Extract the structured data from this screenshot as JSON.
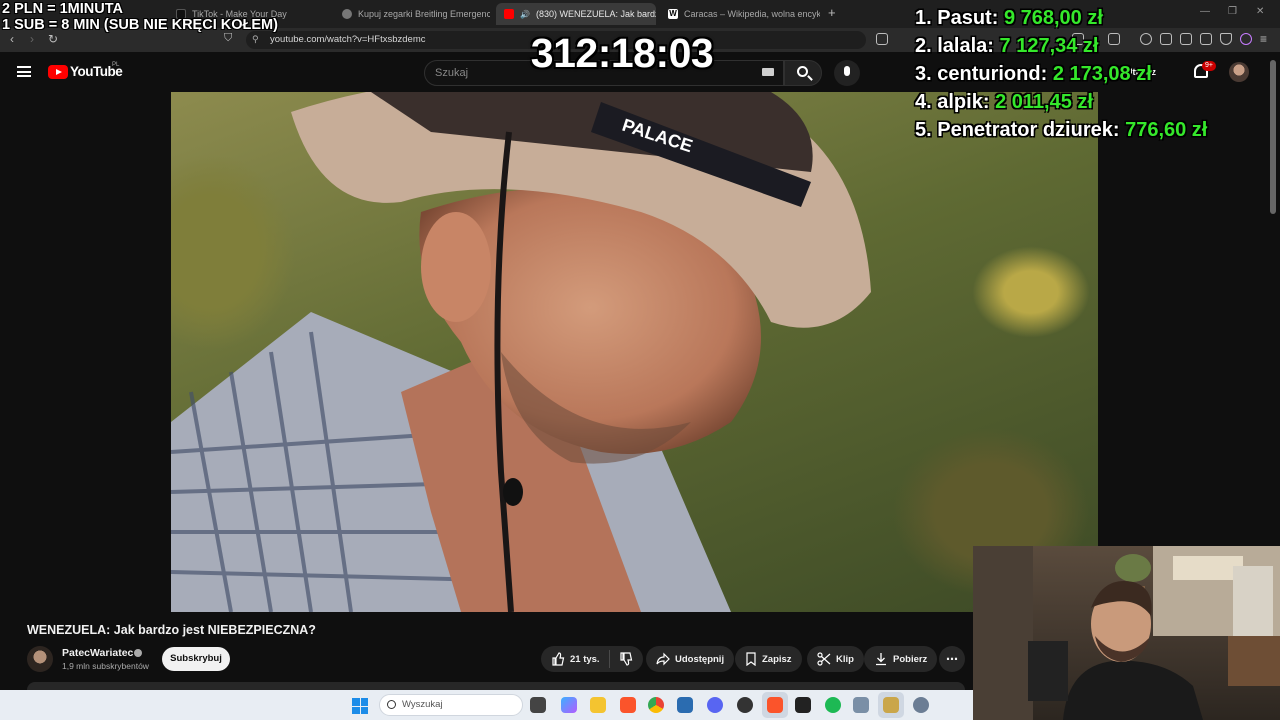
{
  "browser": {
    "tabs": [
      {
        "label": "TikTok - Make Your Day",
        "icon": "tiktok-icon"
      },
      {
        "label": "Kupuj zegarki Breitling Emergency II",
        "icon": "page-icon"
      },
      {
        "label": "(830) WENEZUELA: Jak bardzo",
        "icon": "youtube-icon",
        "active": true
      },
      {
        "label": "Caracas – Wikipedia, wolna encyklop",
        "icon": "wikipedia-icon"
      }
    ],
    "new_tab": "+",
    "url": "youtube.com/watch?v=HFtxsbzdemc"
  },
  "youtube": {
    "logo_text": "YouTube",
    "region": "PL",
    "search_placeholder": "Szukaj",
    "create_label": "Utwórz",
    "notifications": "9+"
  },
  "video": {
    "title": "WENEZUELA: Jak bardzo jest NIEBEZPIECZNA?",
    "channel": "PatecWariatec",
    "subscribers": "1,9 mln subskrybentów",
    "subscribe_label": "Subskrybuj",
    "likes": "21 tys.",
    "share_label": "Udostępnij",
    "save_label": "Zapisz",
    "clip_label": "Klip",
    "download_label": "Pobierz",
    "hat_text": "PALACE"
  },
  "overlay": {
    "rate_line_1": "2 PLN =  1MINUTA",
    "rate_line_2": "1 SUB = 8 MIN (SUB NIE KRĘCI KOŁEM)",
    "timer": "312:18:03",
    "leaderboard": [
      {
        "rank": "1.",
        "name": "Pasut:",
        "amount": "9 768,00 zł"
      },
      {
        "rank": "2.",
        "name": "lalala:",
        "amount": "7 127,34 zł"
      },
      {
        "rank": "3.",
        "name": "centuriond:",
        "amount": "2 173,08 zł"
      },
      {
        "rank": "4.",
        "name": "alpik:",
        "amount": "2 011,45 zł"
      },
      {
        "rank": "5.",
        "name": "Penetrator dziurek:",
        "amount": "776,60 zł"
      }
    ]
  },
  "taskbar": {
    "search_placeholder": "Wyszukaj"
  },
  "colors": {
    "donation_green": "#35e82b",
    "youtube_red": "#ff0000",
    "dark_bg": "#0f0f0f"
  }
}
